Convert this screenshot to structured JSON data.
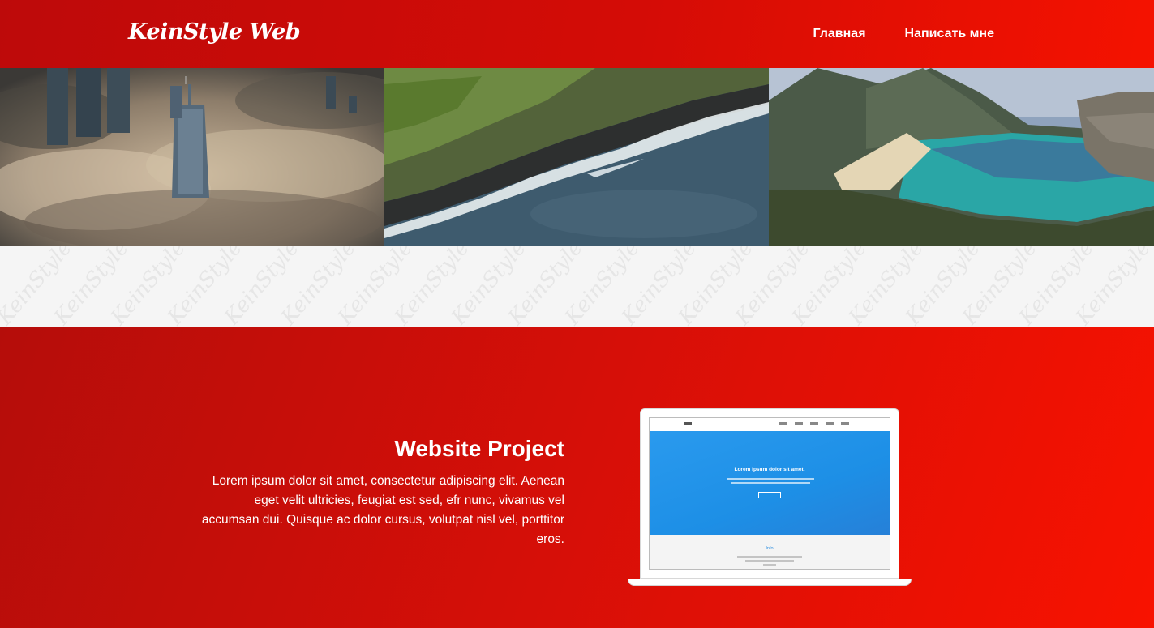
{
  "header": {
    "logo": "KeinStyle Web",
    "nav": [
      {
        "label": "Главная"
      },
      {
        "label": "Написать мне"
      }
    ],
    "gradient": [
      "#bd0a0a",
      "#f51200"
    ]
  },
  "gallery": {
    "photos": [
      {
        "name": "city-skyscrapers-in-clouds"
      },
      {
        "name": "coastline-waves-aerial"
      },
      {
        "name": "mountain-bay-beach"
      }
    ]
  },
  "watermark": {
    "text": "KeinStyle"
  },
  "project": {
    "title": "Website Project",
    "description": "Lorem ipsum dolor sit amet, consectetur adipiscing elit. Aenean eget velit ultricies, feugiat est sed, efr nunc, vivamus vel accumsan dui. Quisque ac dolor cursus, volutpat nisl vel, porttitor eros.",
    "gradient": [
      "#b50d0a",
      "#f81200"
    ]
  },
  "laptop_screen": {
    "hero_title": "Lorem ipsum dolor sit amet.",
    "info_title": "Info",
    "accent": "#2a9aee"
  }
}
